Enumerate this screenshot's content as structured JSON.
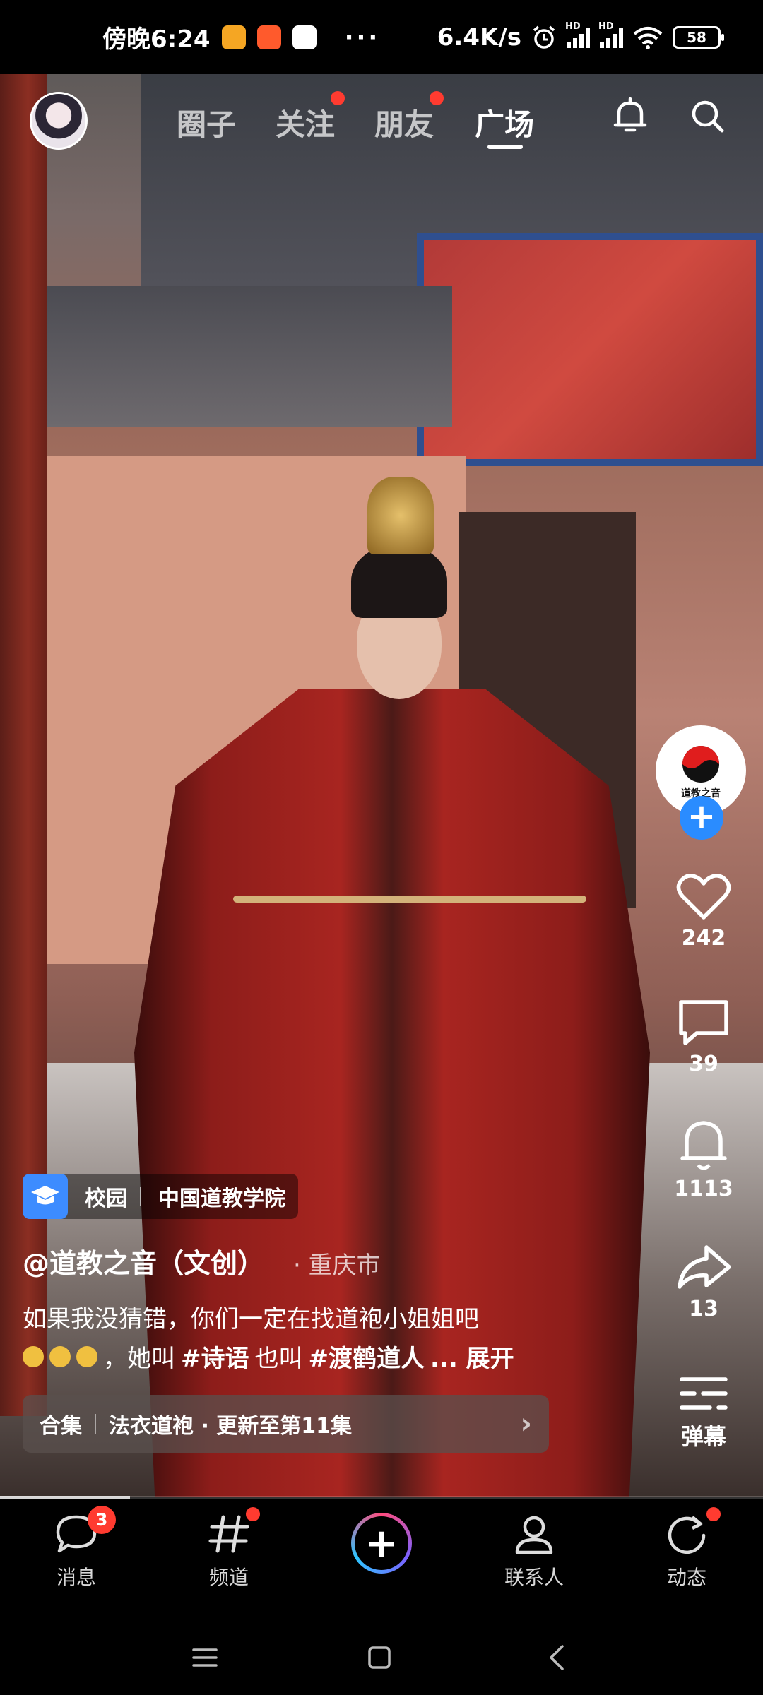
{
  "status_bar": {
    "time": "傍晚6:24",
    "dots": "···",
    "net_speed": "6.4K/s",
    "battery": "58"
  },
  "top_bar": {
    "tabs": [
      {
        "label": "圈子"
      },
      {
        "label": "关注"
      },
      {
        "label": "朋友"
      },
      {
        "label": "广场"
      }
    ]
  },
  "actions": {
    "like_count": "242",
    "comment_count": "39",
    "bell_count": "1113",
    "share_count": "13",
    "danmaku_label": "弹幕",
    "author_logo_text": "道教之音"
  },
  "info": {
    "tag": {
      "category": "校园",
      "name": "中国道教学院"
    },
    "author": "@道教之音（文创）",
    "location": "· 重庆市",
    "desc_line1": "如果我没猜错，你们一定在找道袍小姐姐吧",
    "desc_line2_a": "，她叫",
    "tag1": "#诗语",
    "desc_line2_b": "也叫",
    "tag2": "#渡鹤道人",
    "expand": "... 展开",
    "collection": {
      "label": "合集",
      "title": "法衣道袍 · 更新至第11集"
    },
    "progress": 0.17
  },
  "bottom_nav": {
    "items": [
      {
        "label": "消息",
        "badge": "3"
      },
      {
        "label": "频道"
      },
      {
        "label": "联系人"
      },
      {
        "label": "动态"
      }
    ]
  },
  "colors": {
    "accent_blue": "#2a8cff",
    "badge_red": "#ff3b30"
  }
}
